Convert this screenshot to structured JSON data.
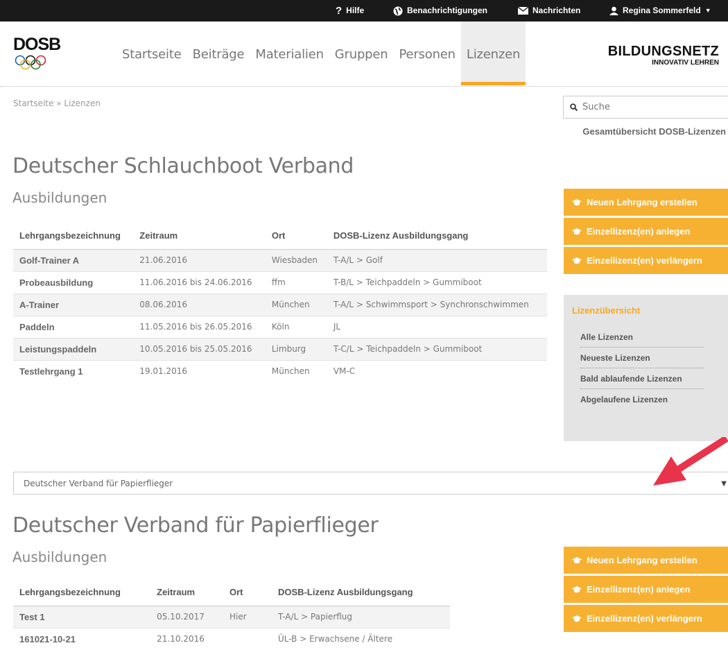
{
  "topbar": {
    "help": "Hilfe",
    "notifications": "Benachrichtigungen",
    "messages": "Nachrichten",
    "user": "Regina Sommerfeld"
  },
  "logo": {
    "text": "DOSB"
  },
  "nav": [
    "Startseite",
    "Beiträge",
    "Materialien",
    "Gruppen",
    "Personen",
    "Lizenzen"
  ],
  "nav_active": "Lizenzen",
  "brand": {
    "line1": "BILDUNGSNETZ",
    "line2": "INNOVATIV LEHREN"
  },
  "breadcrumb": "Startseite » Lizenzen",
  "search": {
    "placeholder": "Suche"
  },
  "overview_link": "Gesamtübersicht DOSB-Lizenzen",
  "colors": {
    "accent": "#f7a823",
    "button": "#f7b132",
    "topbar": "#1a1a1a",
    "arrow": "#e8334a"
  },
  "section1": {
    "title": "Deutscher Schlauchboot Verband",
    "subtitle": "Ausbildungen",
    "headers": [
      "Lehrgangsbezeichnung",
      "Zeitraum",
      "Ort",
      "DOSB-Lizenz Ausbildungsgang"
    ],
    "rows": [
      [
        "Golf-Trainer A",
        "21.06.2016",
        "Wiesbaden",
        "T-A/L > Golf"
      ],
      [
        "Probeausbildung",
        "11.06.2016 bis 24.06.2016",
        "ffm",
        "T-B/L > Teichpaddeln > Gummiboot"
      ],
      [
        "A-Trainer",
        "08.06.2016",
        "München",
        "T-A/L > Schwimmsport > Synchronschwimmen"
      ],
      [
        "Paddeln",
        "11.05.2016 bis 26.05.2016",
        "Köln",
        "JL"
      ],
      [
        "Leistungspaddeln",
        "10.05.2016 bis 25.05.2016",
        "Limburg",
        "T-C/L > Teichpaddeln > Gummiboot"
      ],
      [
        "Testlehrgang 1",
        "19.01.2016",
        "München",
        "VM-C"
      ]
    ]
  },
  "actions": [
    "Neuen Lehrgang erstellen",
    "Einzellizenz(en) anlegen",
    "Einzellizenz(en) verlängern"
  ],
  "license_overview": {
    "title": "Lizenzübersicht",
    "items": [
      "Alle Lizenzen",
      "Neueste Lizenzen",
      "Bald ablaufende Lizenzen",
      "Abgelaufene Lizenzen"
    ]
  },
  "select": {
    "value": "Deutscher Verband für Papierflieger"
  },
  "section2": {
    "title": "Deutscher Verband für Papierflieger",
    "subtitle": "Ausbildungen",
    "headers": [
      "Lehrgangsbezeichnung",
      "Zeitraum",
      "Ort",
      "DOSB-Lizenz Ausbildungsgang"
    ],
    "rows": [
      [
        "Test 1",
        "05.10.2017",
        "Hier",
        "T-A/L > Papierflug"
      ],
      [
        "161021-10-21",
        "21.10.2016",
        "",
        "ÜL-B > Erwachsene / Ältere"
      ]
    ]
  }
}
